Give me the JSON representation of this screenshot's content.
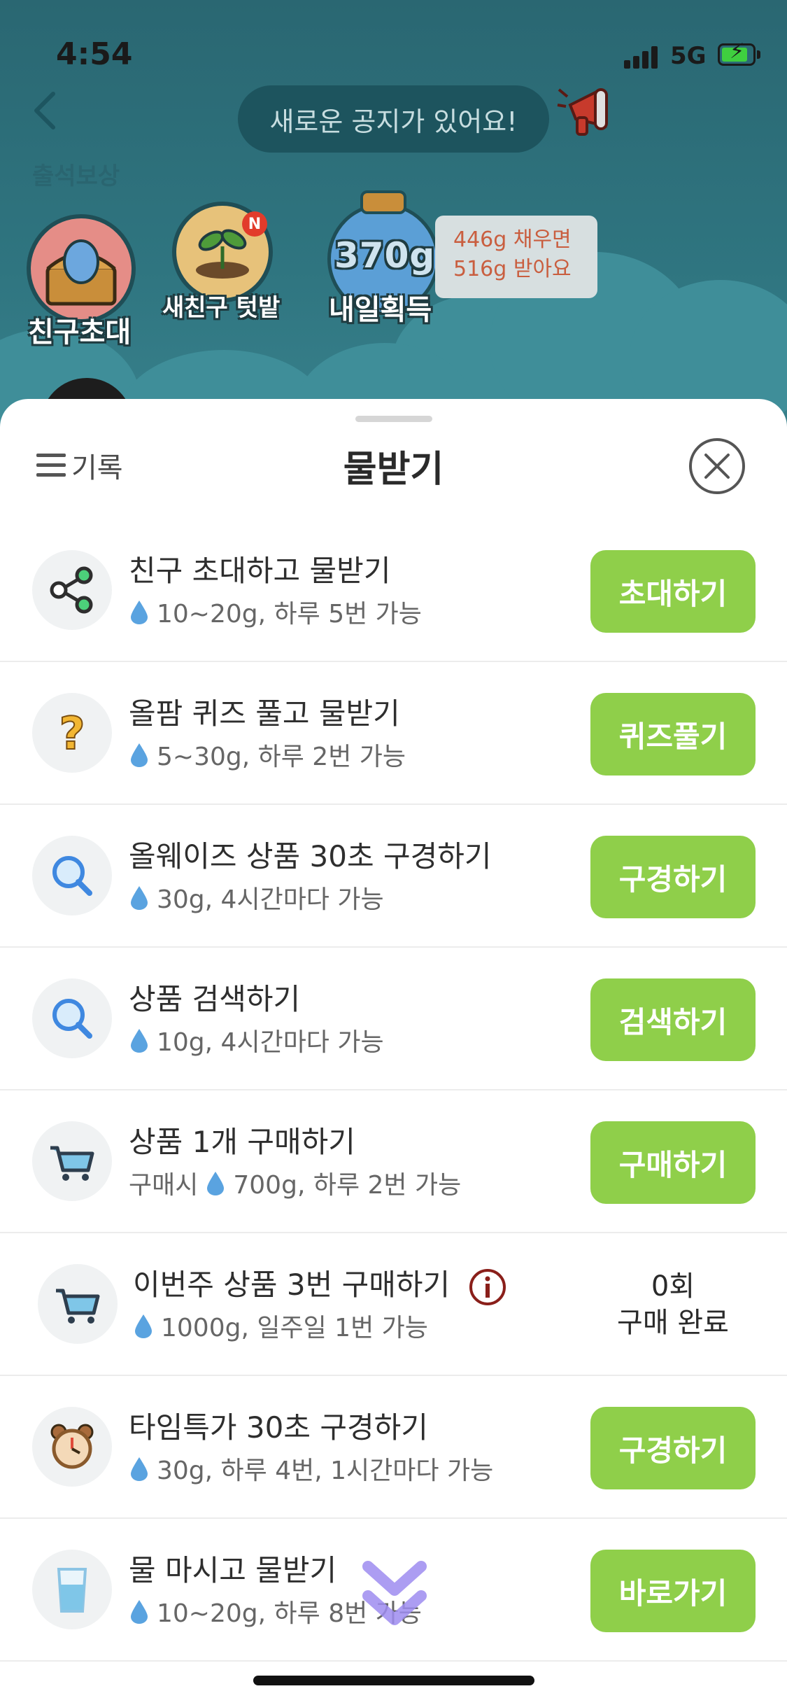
{
  "status_bar": {
    "time": "4:54",
    "network": "5G"
  },
  "header": {
    "notice": "새로운 공지가 있어요!",
    "faded_title": "출석보상"
  },
  "quick_icons": {
    "invite_label": "친구초대",
    "new_friend_field_label": "새친구 텃밭",
    "new_badge": "N",
    "tomorrow_label": "내일획득",
    "jar_amount": "370g",
    "tip_line1": "446g 채우면",
    "tip_line2": "516g 받아요"
  },
  "sheet": {
    "history_label": "기록",
    "title": "물받기",
    "tasks": [
      {
        "title": "친구 초대하고 물받기",
        "prefix": "",
        "detail": "10~20g, 하루 5번 가능",
        "action": "초대하기",
        "icon": "share-icon"
      },
      {
        "title": "올팜 퀴즈 풀고 물받기",
        "prefix": "",
        "detail": "5~30g, 하루 2번 가능",
        "action": "퀴즈풀기",
        "icon": "question-icon"
      },
      {
        "title": "올웨이즈 상품 30초 구경하기",
        "prefix": "",
        "detail": "30g, 4시간마다 가능",
        "action": "구경하기",
        "icon": "magnifier-icon"
      },
      {
        "title": "상품 검색하기",
        "prefix": "",
        "detail": "10g, 4시간마다 가능",
        "action": "검색하기",
        "icon": "magnifier-icon"
      },
      {
        "title": "상품 1개 구매하기",
        "prefix": "구매시",
        "detail": "700g, 하루 2번 가능",
        "action": "구매하기",
        "icon": "cart-icon"
      },
      {
        "title": "이번주 상품 3번 구매하기",
        "prefix": "",
        "detail": "1000g, 일주일 1번 가능",
        "status_line1": "0회",
        "status_line2": "구매 완료",
        "icon": "cart-icon"
      },
      {
        "title": "타임특가 30초 구경하기",
        "prefix": "",
        "detail": "30g, 하루 4번, 1시간마다 가능",
        "action": "구경하기",
        "icon": "alarm-clock-icon"
      },
      {
        "title": "물 마시고 물받기",
        "prefix": "",
        "detail": "10~20g, 하루 8번 가능",
        "action": "바로가기",
        "icon": "water-glass-icon"
      }
    ]
  },
  "colors": {
    "action_green": "#8FCF4A",
    "scene_teal": "#2F7580",
    "tip_text": "#C95E3F"
  }
}
